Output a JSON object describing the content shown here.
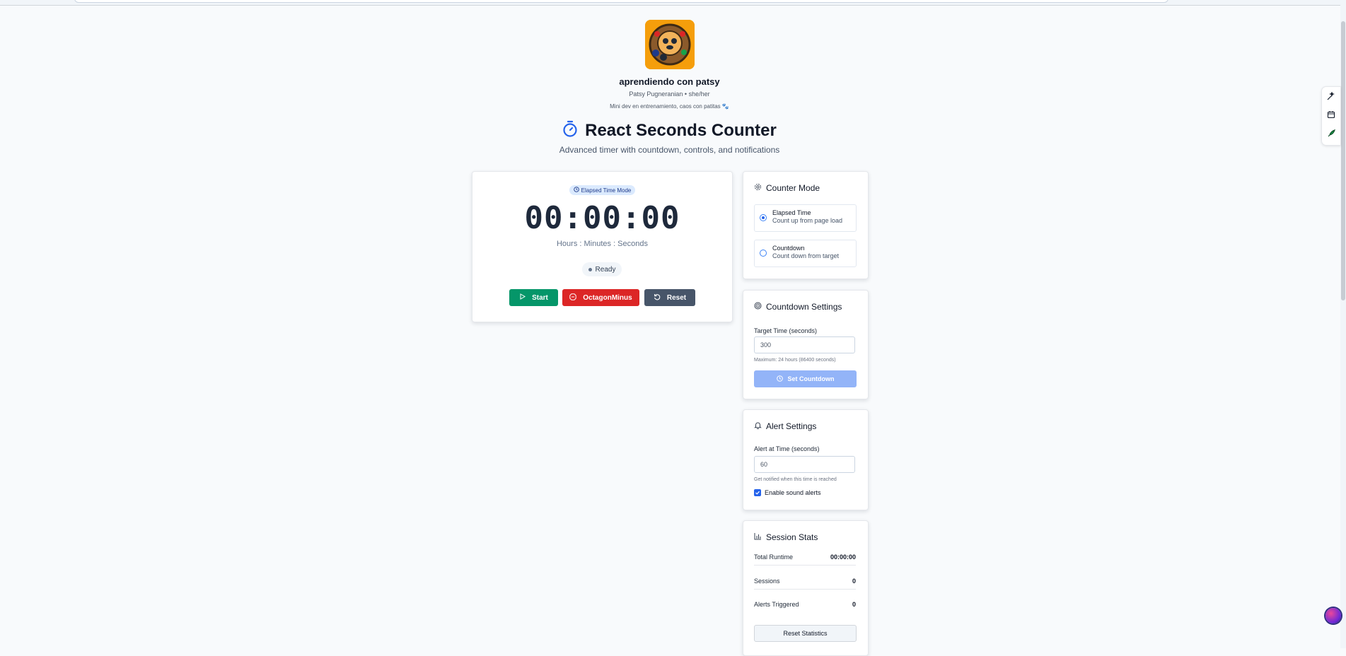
{
  "profile": {
    "name": "aprendiendo con patsy",
    "subtitle": "Patsy Pugneranian • she/her",
    "bio": "Mini dev en entrenamiento, caos con patitas 🐾"
  },
  "header": {
    "title": "React Seconds Counter",
    "subtitle": "Advanced timer with countdown, controls, and notifications"
  },
  "timer": {
    "mode_badge": "Elapsed Time Mode",
    "time": "00:00:00",
    "units": "Hours : Minutes : Seconds",
    "status": "Ready",
    "start_label": "Start",
    "pause_label": "OctagonMinus",
    "reset_label": "Reset"
  },
  "counter_mode": {
    "title": "Counter Mode",
    "options": [
      {
        "title": "Elapsed Time",
        "desc": "Count up from page load",
        "selected": true
      },
      {
        "title": "Countdown",
        "desc": "Count down from target",
        "selected": false
      }
    ]
  },
  "countdown_settings": {
    "title": "Countdown Settings",
    "label": "Target Time (seconds)",
    "value": "300",
    "hint": "Maximum: 24 hours (86400 seconds)",
    "button_label": "Set Countdown"
  },
  "alert_settings": {
    "title": "Alert Settings",
    "label": "Alert at Time (seconds)",
    "value": "60",
    "hint": "Get notified when this time is reached",
    "sound_label": "Enable sound alerts",
    "sound_enabled": true
  },
  "session_stats": {
    "title": "Session Stats",
    "rows": [
      {
        "label": "Total Runtime",
        "value": "00:00:00"
      },
      {
        "label": "Sessions",
        "value": "0"
      },
      {
        "label": "Alerts Triggered",
        "value": "0"
      }
    ],
    "reset_label": "Reset Statistics"
  },
  "colors": {
    "start": "#059669",
    "stop": "#dc2626",
    "reset": "#475569",
    "accent": "#2563eb"
  }
}
